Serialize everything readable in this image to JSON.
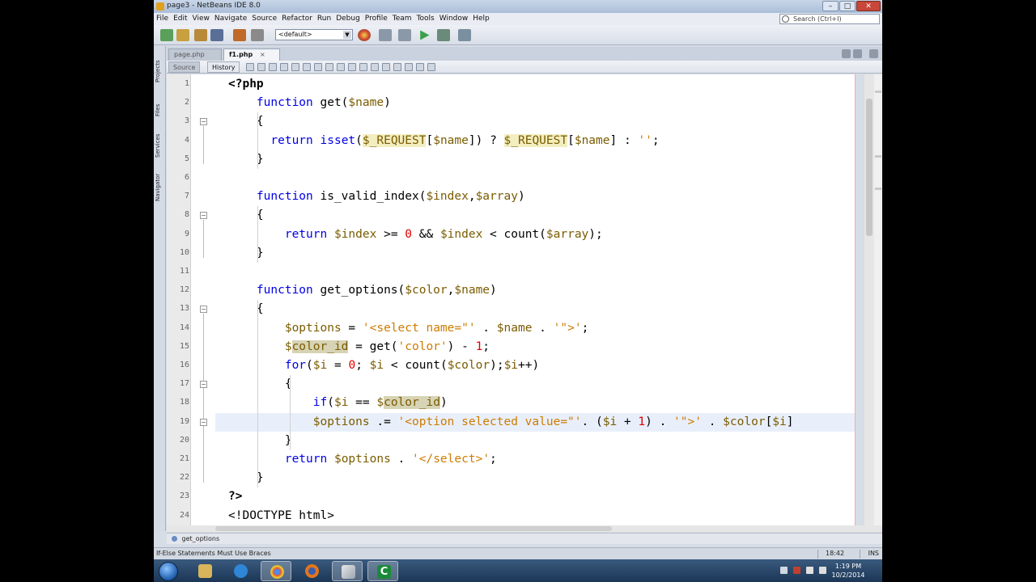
{
  "window": {
    "title": "page3 - NetBeans IDE 8.0"
  },
  "window_controls": {
    "minimize": "–",
    "maximize": "□",
    "close": "✕"
  },
  "menu": [
    "File",
    "Edit",
    "View",
    "Navigate",
    "Source",
    "Refactor",
    "Run",
    "Debug",
    "Profile",
    "Team",
    "Tools",
    "Window",
    "Help"
  ],
  "search": {
    "placeholder": "Search (Ctrl+I)"
  },
  "toolbar": {
    "config": "<default>"
  },
  "side_tabs": [
    "Projects",
    "Files",
    "Services",
    "Navigator"
  ],
  "editor_tabs": {
    "inactive": "page.php",
    "active": "f1.php",
    "close": "×"
  },
  "editor_toolbar": {
    "source": "Source",
    "history": "History"
  },
  "line_numbers": [
    "1",
    "2",
    "3",
    "4",
    "5",
    "6",
    "7",
    "8",
    "9",
    "10",
    "11",
    "12",
    "13",
    "14",
    "15",
    "16",
    "17",
    "18",
    "19",
    "20",
    "21",
    "22",
    "23",
    "24"
  ],
  "code_lines": [
    [
      {
        "t": "<?php",
        "c": "tag"
      }
    ],
    [
      {
        "t": "    "
      },
      {
        "t": "function",
        "c": "kw"
      },
      {
        "t": " get("
      },
      {
        "t": "$name",
        "c": "vr"
      },
      {
        "t": ")"
      }
    ],
    [
      {
        "t": "    {"
      }
    ],
    [
      {
        "t": "      "
      },
      {
        "t": "return",
        "c": "kw"
      },
      {
        "t": " "
      },
      {
        "t": "isset",
        "c": "kw"
      },
      {
        "t": "("
      },
      {
        "t": "$_REQUEST",
        "c": "vr hl"
      },
      {
        "t": "["
      },
      {
        "t": "$name",
        "c": "vr"
      },
      {
        "t": "]) ? "
      },
      {
        "t": "$_REQUEST",
        "c": "vr hl"
      },
      {
        "t": "["
      },
      {
        "t": "$name",
        "c": "vr"
      },
      {
        "t": "] : "
      },
      {
        "t": "''",
        "c": "st"
      },
      {
        "t": ";"
      }
    ],
    [
      {
        "t": "    }"
      }
    ],
    [
      {
        "t": ""
      }
    ],
    [
      {
        "t": "    "
      },
      {
        "t": "function",
        "c": "kw"
      },
      {
        "t": " is_valid_index("
      },
      {
        "t": "$index",
        "c": "vr"
      },
      {
        "t": ","
      },
      {
        "t": "$array",
        "c": "vr"
      },
      {
        "t": ")"
      }
    ],
    [
      {
        "t": "    {"
      }
    ],
    [
      {
        "t": "        "
      },
      {
        "t": "return",
        "c": "kw"
      },
      {
        "t": " "
      },
      {
        "t": "$index",
        "c": "vr"
      },
      {
        "t": " >= "
      },
      {
        "t": "0",
        "c": "num"
      },
      {
        "t": " && "
      },
      {
        "t": "$index",
        "c": "vr"
      },
      {
        "t": " < count("
      },
      {
        "t": "$array",
        "c": "vr"
      },
      {
        "t": ");"
      }
    ],
    [
      {
        "t": "    }"
      }
    ],
    [
      {
        "t": ""
      }
    ],
    [
      {
        "t": "    "
      },
      {
        "t": "function",
        "c": "kw"
      },
      {
        "t": " get_options("
      },
      {
        "t": "$color",
        "c": "vr"
      },
      {
        "t": ","
      },
      {
        "t": "$name",
        "c": "vr"
      },
      {
        "t": ")"
      }
    ],
    [
      {
        "t": "    {"
      }
    ],
    [
      {
        "t": "        "
      },
      {
        "t": "$options",
        "c": "vr"
      },
      {
        "t": " = "
      },
      {
        "t": "'<select name=\"'",
        "c": "st"
      },
      {
        "t": " . "
      },
      {
        "t": "$name",
        "c": "vr"
      },
      {
        "t": " . "
      },
      {
        "t": "'\">'",
        "c": "st"
      },
      {
        "t": ";"
      }
    ],
    [
      {
        "t": "        "
      },
      {
        "t": "$",
        "c": "vr"
      },
      {
        "t": "color_id",
        "c": "vr ocur"
      },
      {
        "t": " = get("
      },
      {
        "t": "'color'",
        "c": "st"
      },
      {
        "t": ") - "
      },
      {
        "t": "1",
        "c": "num"
      },
      {
        "t": ";"
      }
    ],
    [
      {
        "t": "        "
      },
      {
        "t": "for",
        "c": "kw"
      },
      {
        "t": "("
      },
      {
        "t": "$i",
        "c": "vr"
      },
      {
        "t": " = "
      },
      {
        "t": "0",
        "c": "num"
      },
      {
        "t": "; "
      },
      {
        "t": "$i",
        "c": "vr"
      },
      {
        "t": " < count("
      },
      {
        "t": "$color",
        "c": "vr"
      },
      {
        "t": ");"
      },
      {
        "t": "$i",
        "c": "vr"
      },
      {
        "t": "++)"
      }
    ],
    [
      {
        "t": "        {"
      }
    ],
    [
      {
        "t": "            "
      },
      {
        "t": "if",
        "c": "kw"
      },
      {
        "t": "("
      },
      {
        "t": "$i",
        "c": "vr"
      },
      {
        "t": " == "
      },
      {
        "t": "$",
        "c": "vr"
      },
      {
        "t": "color_id",
        "c": "vr ocur"
      },
      {
        "t": ")"
      }
    ],
    [
      {
        "t": "            "
      },
      {
        "t": "$options",
        "c": "vr"
      },
      {
        "t": " .= "
      },
      {
        "t": "'<option selected value=\"'",
        "c": "st"
      },
      {
        "t": ". ("
      },
      {
        "t": "$i",
        "c": "vr"
      },
      {
        "t": " + "
      },
      {
        "t": "1",
        "c": "num"
      },
      {
        "t": ") . "
      },
      {
        "t": "'\">'",
        "c": "st"
      },
      {
        "t": " . "
      },
      {
        "t": "$color",
        "c": "vr"
      },
      {
        "t": "["
      },
      {
        "t": "$i",
        "c": "vr"
      },
      {
        "t": "]"
      }
    ],
    [
      {
        "t": "        }"
      }
    ],
    [
      {
        "t": "        "
      },
      {
        "t": "return",
        "c": "kw"
      },
      {
        "t": " "
      },
      {
        "t": "$options",
        "c": "vr"
      },
      {
        "t": " . "
      },
      {
        "t": "'</select>'",
        "c": "st"
      },
      {
        "t": ";"
      }
    ],
    [
      {
        "t": "    }"
      }
    ],
    [
      {
        "t": "?>",
        "c": "tag"
      }
    ],
    [
      {
        "t": "<!DOCTYPE html>"
      }
    ]
  ],
  "current_line": 19,
  "navigator": {
    "breadcrumb": "get_options"
  },
  "status": {
    "hint": "If-Else Statements Must Use Braces",
    "position": "18:42",
    "mode": "INS"
  },
  "clock": {
    "time": "1:19 PM",
    "date": "10/2/2014"
  },
  "colors": {
    "keyword": "#0000e6",
    "variable": "#7a5c00",
    "string": "#ce7b00",
    "number": "#e00000",
    "occurrence": "#d7d3b5"
  }
}
